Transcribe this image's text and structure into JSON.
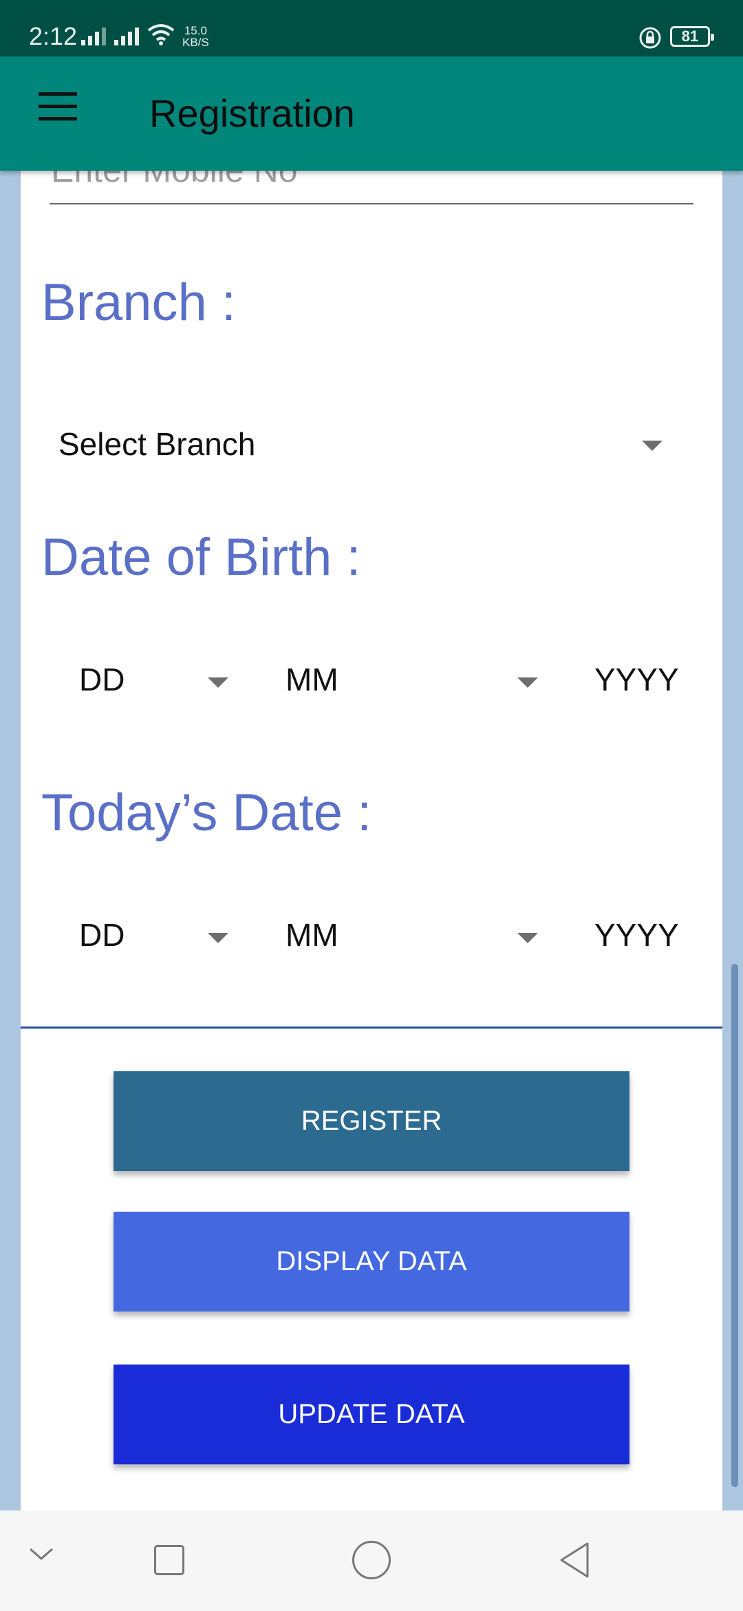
{
  "status_bar": {
    "time": "2:12",
    "net_speed_value": "15.0",
    "net_speed_unit": "KB/S",
    "battery": "81"
  },
  "app_bar": {
    "title": "Registration",
    "menu_icon": "hamburger-menu-icon"
  },
  "form": {
    "mobile_placeholder": "Enter Mobile No",
    "branch_label": "Branch :",
    "branch_select": "Select Branch",
    "dob_label": "Date of Birth :",
    "dob": {
      "day": "DD",
      "month": "MM",
      "year": "YYYY"
    },
    "today_label": "Today’s Date :",
    "today": {
      "day": "DD",
      "month": "MM",
      "year": "YYYY"
    }
  },
  "buttons": {
    "register": "REGISTER",
    "display": "DISPLAY DATA",
    "update": "UPDATE DATA"
  },
  "colors": {
    "status_bar": "#004f45",
    "app_bar": "#00867a",
    "label": "#5a6fc6",
    "register": "#2d6a8f",
    "display": "#4468e0",
    "update": "#1a2bd8"
  },
  "nav_bar": {
    "icons": [
      "chevron-down-icon",
      "recents-square-icon",
      "home-circle-icon",
      "back-triangle-icon"
    ]
  }
}
